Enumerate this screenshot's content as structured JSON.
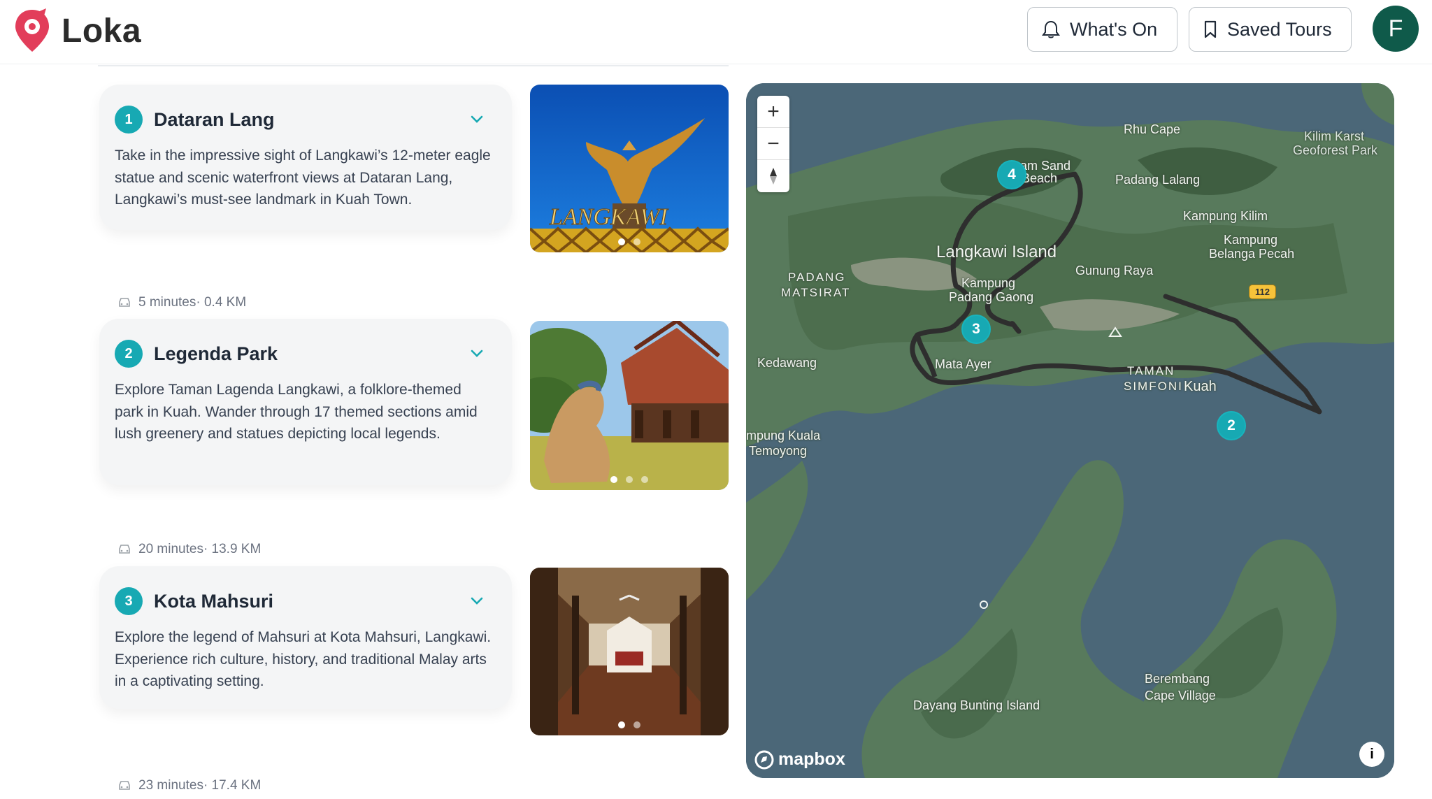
{
  "app": {
    "name": "Loka"
  },
  "header": {
    "whats_on_label": "What's On",
    "saved_tours_label": "Saved Tours",
    "avatar_initial": "F"
  },
  "stops": [
    {
      "number": "1",
      "title": "Dataran Lang",
      "description": "Take in the impressive sight of Langkawi’s 12-meter eagle statue and scenic waterfront views at Dataran Lang, Langkawi’s must-see landmark in Kuah Town.",
      "photo_icon": "eagle-statue-photo"
    },
    {
      "number": "2",
      "title": "Legenda Park",
      "description": "Explore Taman Lagenda Langkawi, a folklore-themed park in Kuah. Wander through 17 themed sections amid lush greenery and statues depicting local legends.",
      "photo_icon": "legenda-park-photo"
    },
    {
      "number": "3",
      "title": "Kota Mahsuri",
      "description": "Explore the legend of Mahsuri at Kota Mahsuri, Langkawi. Experience rich culture, history, and traditional Malay arts in a captivating setting.",
      "photo_icon": "kota-mahsuri-photo"
    }
  ],
  "travel": [
    "5 minutes· 0.4 KM",
    "20 minutes· 13.9 KM",
    "23 minutes· 17.4 KM"
  ],
  "map": {
    "zoom_in": "+",
    "zoom_out": "−",
    "labels": {
      "rhu_cape": "Rhu Cape",
      "kilim_karst_1": "Kilim Karst",
      "kilim_karst_2": "Geoforest Park",
      "tanjung_beach_1": "am Sand",
      "tanjung_beach_2": "Beach",
      "padang_lalang": "Padang Lalang",
      "kampung_kilim": "Kampung Kilim",
      "belanga_1": "Kampung",
      "belanga_2": "Belanga Pecah",
      "langkawi_island": "Langkawi Island",
      "gunung_raya": "Gunung Raya",
      "padang_matsirat_1": "PADANG",
      "padang_matsirat_2": "MATSIRAT",
      "padang_gaong_1": "Kampung",
      "padang_gaong_2": "Padang Gaong",
      "route_112": "112",
      "kedawang": "Kedawang",
      "mata_ayer": "Mata Ayer",
      "taman_simfoni_1": "TAMAN",
      "taman_simfoni_2": "SIMFONI",
      "kuah": "Kuah",
      "kuala_temoyong_1": "mpung Kuala",
      "kuala_temoyong_2": "Temoyong",
      "dayang_bunting": "Dayang Bunting Island",
      "berembang_1": "Berembang",
      "berembang_2": "Cape Village"
    },
    "pins": [
      "4",
      "3",
      "2"
    ],
    "brand": "mapbox",
    "info": "i",
    "colors": {
      "water": "#4b6778",
      "land": "#587a5c",
      "route": "#2e2e2e",
      "pin": "#17a9b3"
    }
  },
  "colors": {
    "accent": "#17a9b3",
    "avatar": "#0f5a4a",
    "logo": "#e23d5a"
  }
}
